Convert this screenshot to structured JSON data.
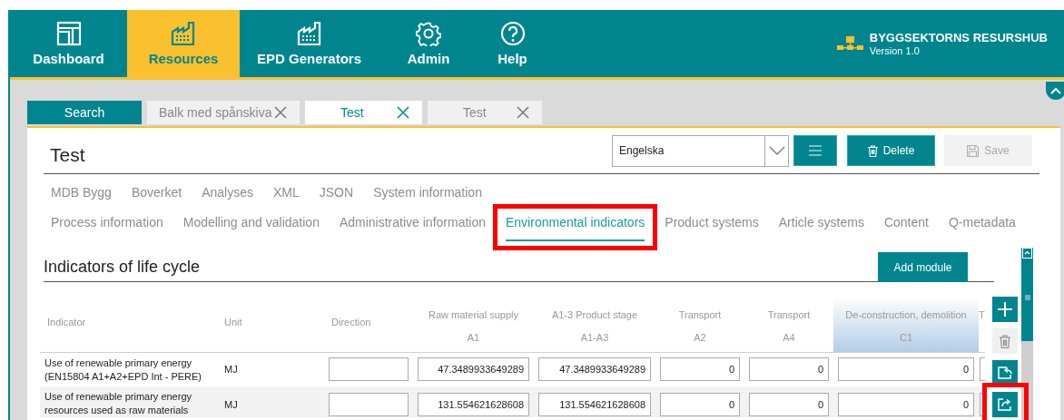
{
  "nav": {
    "items": [
      {
        "label": "Dashboard",
        "selected": false
      },
      {
        "label": "Resources",
        "selected": true
      },
      {
        "label": "EPD Generators",
        "selected": false
      },
      {
        "label": "Admin",
        "selected": false
      },
      {
        "label": "Help",
        "selected": false
      }
    ]
  },
  "brand": {
    "title": "BYGGSEKTORNS RESURSHUB",
    "version": "Version 1.0"
  },
  "tabs": [
    {
      "label": "Search",
      "kind": "search",
      "selected": false
    },
    {
      "label": "Balk med spånskiva",
      "kind": "record",
      "selected": false
    },
    {
      "label": "Test",
      "kind": "record",
      "selected": true
    },
    {
      "label": "Test",
      "kind": "record",
      "selected": false
    }
  ],
  "record": {
    "title": "Test",
    "language": "Engelska",
    "buttons": [
      {
        "label": "Delete",
        "kind": "delete",
        "disabled": false
      },
      {
        "label": "Save",
        "kind": "save",
        "disabled": true
      }
    ]
  },
  "sections": [
    [
      {
        "label": "MDB Bygg",
        "selected": false,
        "highlighted": false
      },
      {
        "label": "Boverket",
        "selected": false,
        "highlighted": false
      },
      {
        "label": "Analyses",
        "selected": false,
        "highlighted": false
      },
      {
        "label": "XML",
        "selected": false,
        "highlighted": false
      },
      {
        "label": "JSON",
        "selected": false,
        "highlighted": false
      },
      {
        "label": "System information",
        "selected": false,
        "highlighted": false
      }
    ],
    [
      {
        "label": "Process information",
        "selected": false,
        "highlighted": false
      },
      {
        "label": "Modelling and validation",
        "selected": false,
        "highlighted": false
      },
      {
        "label": "Administrative information",
        "selected": false,
        "highlighted": false
      },
      {
        "label": "Environmental indicators",
        "selected": true,
        "highlighted": true
      },
      {
        "label": "Product systems",
        "selected": false,
        "highlighted": false
      },
      {
        "label": "Article systems",
        "selected": false,
        "highlighted": false
      },
      {
        "label": "Content",
        "selected": false,
        "highlighted": false
      },
      {
        "label": "Q-metadata",
        "selected": false,
        "highlighted": false
      }
    ]
  ],
  "panel": {
    "title": "Indicators of life cycle",
    "add_button": "Add module"
  },
  "table": {
    "columns": [
      {
        "label": "Indicator",
        "selected": false
      },
      {
        "label": "Unit",
        "selected": false
      },
      {
        "label": "Direction",
        "selected": false
      },
      {
        "label": "Raw material supply",
        "code": "A1",
        "selected": false
      },
      {
        "label": "A1-3 Product stage",
        "code": "A1-A3",
        "selected": false
      },
      {
        "label": "Transport",
        "code": "A2",
        "selected": false
      },
      {
        "label": "Transport",
        "code": "A4",
        "selected": false
      },
      {
        "label": "De-construction, demolition",
        "code": "C1",
        "selected": true
      },
      {
        "label": "T",
        "selected": false
      }
    ],
    "rows": [
      {
        "indicator": "Use of renewable primary energy (EN15804 A1+A2+EPD Int - PERE)",
        "unit": "MJ",
        "values": [
          "47.3489933649289",
          "47.3489933649289",
          "0",
          "0",
          "0"
        ]
      },
      {
        "indicator": "Use of renewable primary energy resources used as raw materials",
        "unit": "MJ",
        "values": [
          "131.554621628608",
          "131.554621628608",
          "0",
          "0",
          "0"
        ]
      }
    ]
  },
  "side_buttons": [
    {
      "kind": "add",
      "disabled": false,
      "highlighted": false
    },
    {
      "kind": "delete",
      "disabled": true,
      "highlighted": false
    },
    {
      "kind": "import",
      "disabled": false,
      "highlighted": false
    },
    {
      "kind": "export",
      "disabled": false,
      "highlighted": true
    }
  ]
}
